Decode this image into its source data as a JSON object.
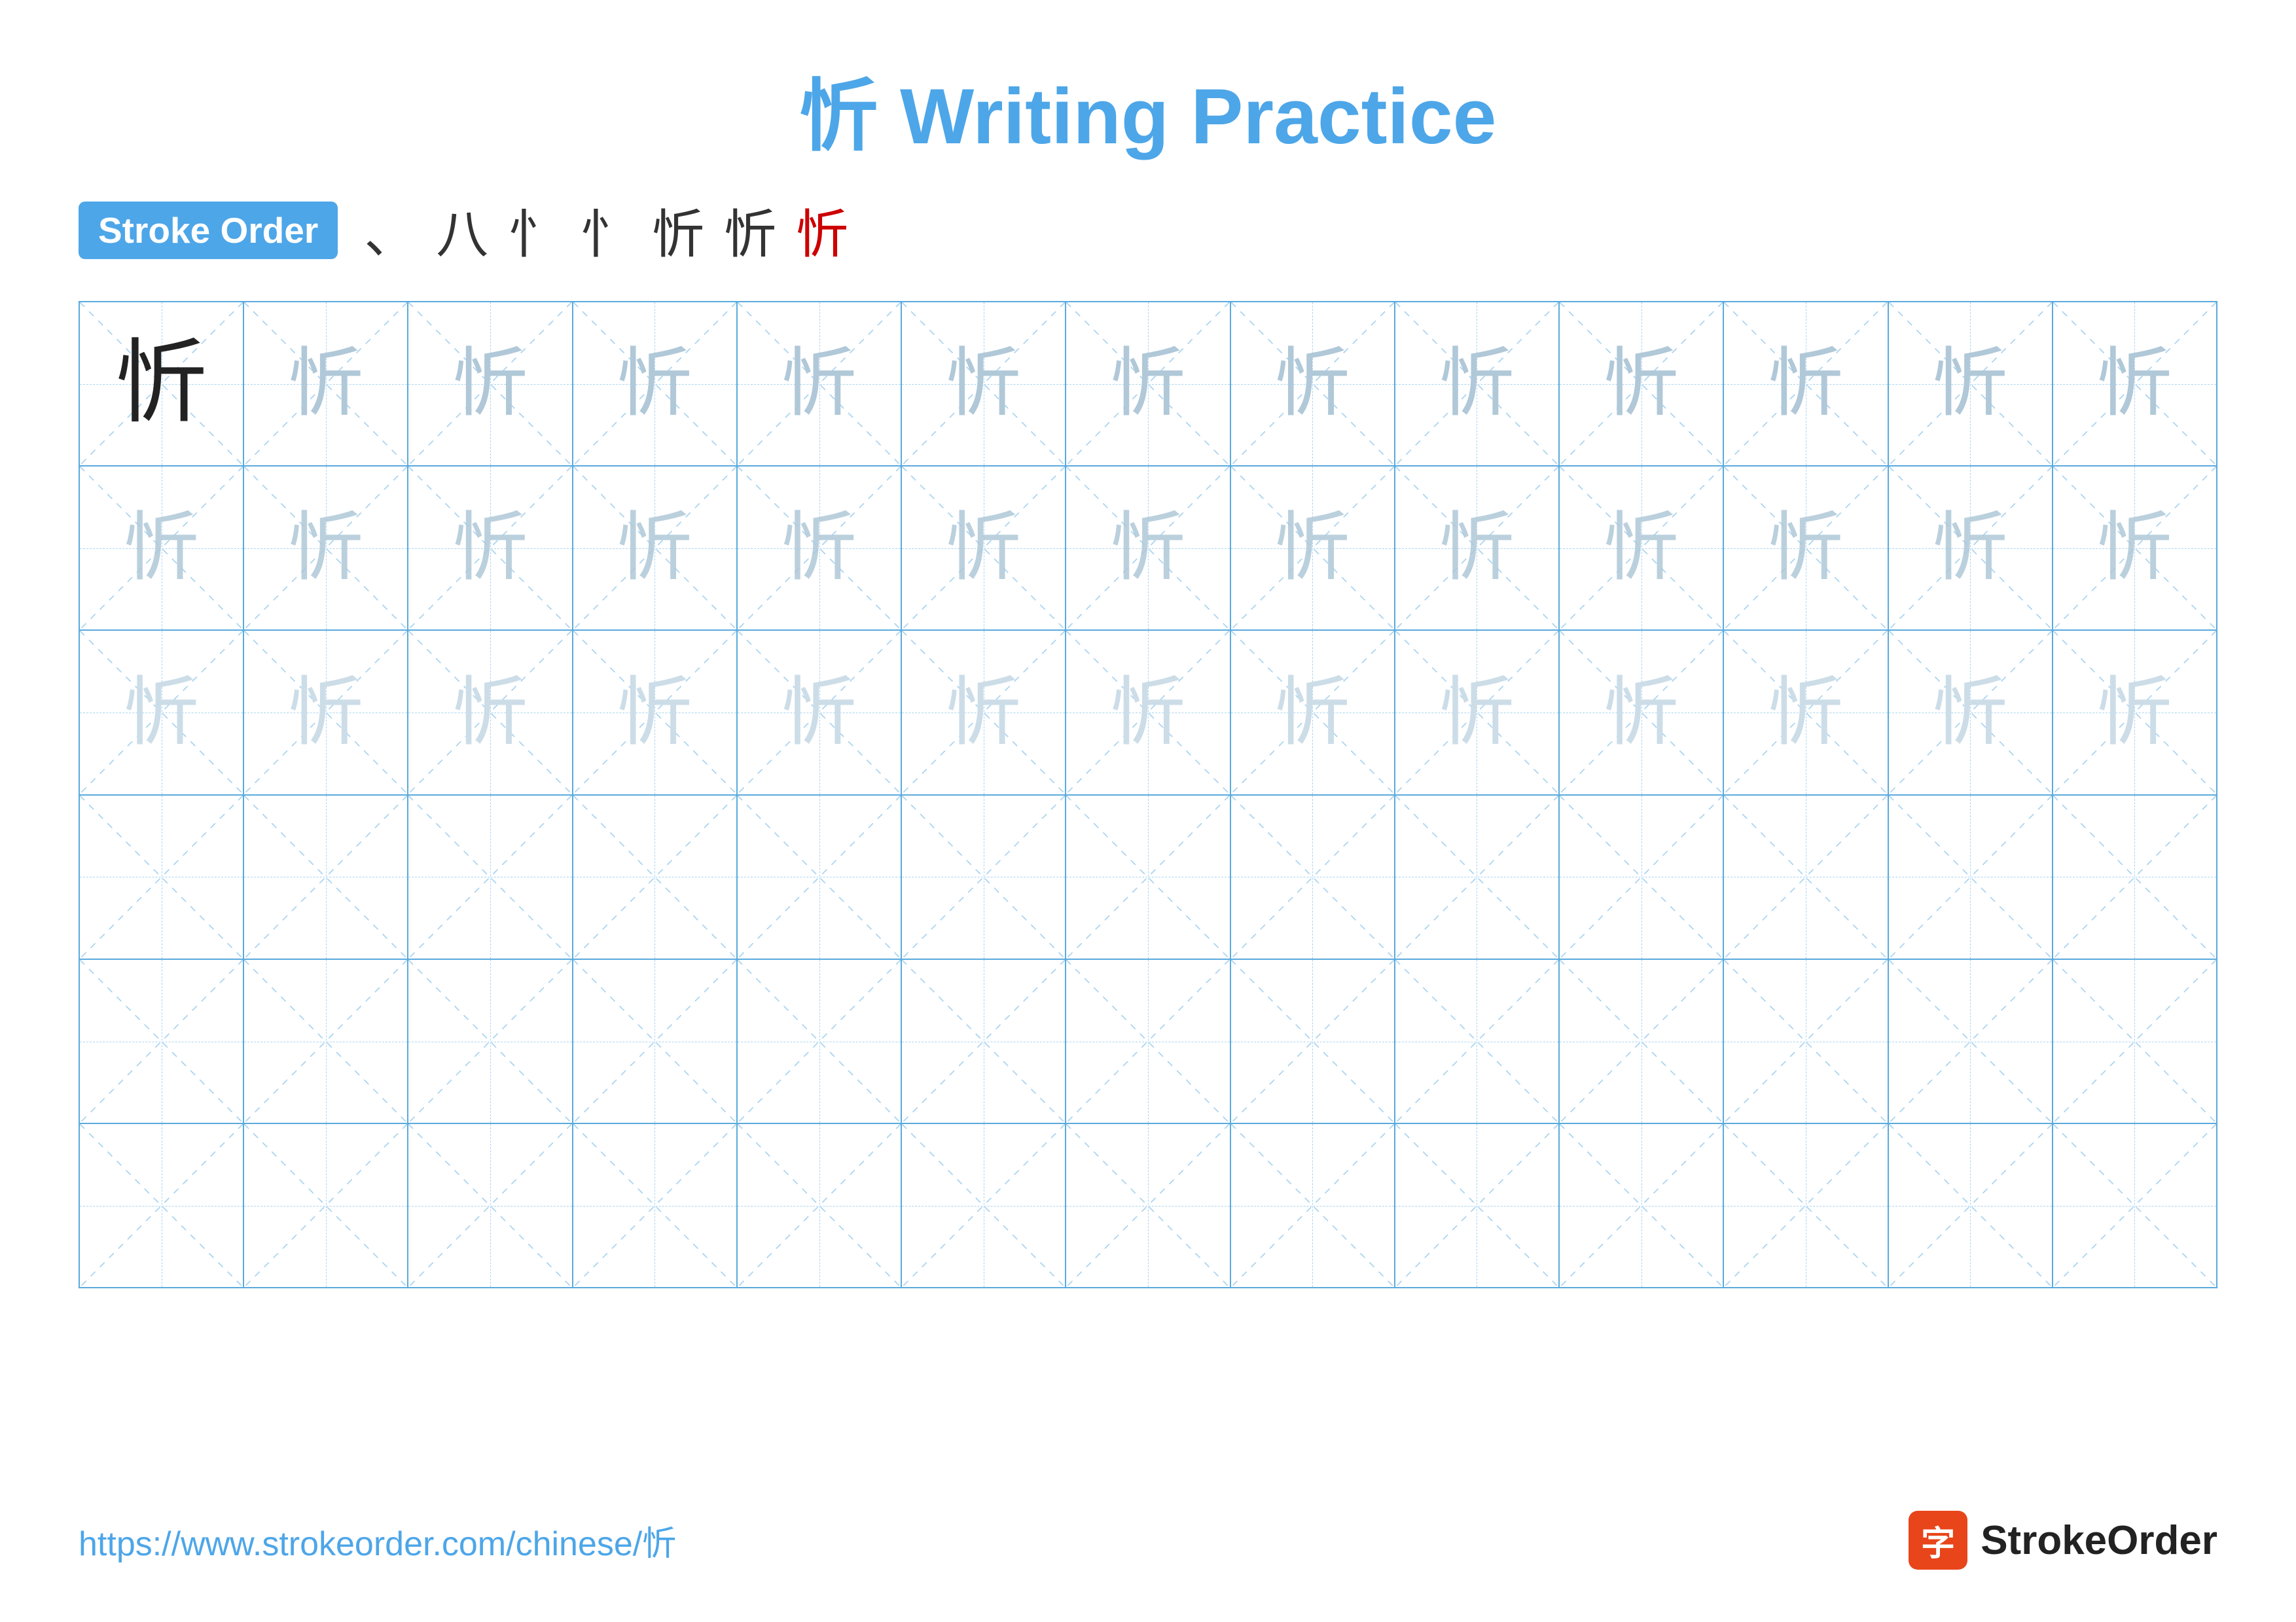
{
  "title": "忻 Writing Practice",
  "stroke_order_badge": "Stroke Order",
  "stroke_sequence": [
    "、",
    "八",
    "忄",
    "忄",
    "忻",
    "忻",
    "忻"
  ],
  "stroke_sequence_last_red_index": 6,
  "character": "忻",
  "rows": [
    {
      "type": "dark",
      "count": 13
    },
    {
      "type": "medium",
      "count": 13
    },
    {
      "type": "light",
      "count": 13
    },
    {
      "type": "empty",
      "count": 13
    },
    {
      "type": "empty",
      "count": 13
    },
    {
      "type": "empty",
      "count": 13
    }
  ],
  "footer_url": "https://www.strokeorder.com/chinese/忻",
  "logo_char": "字",
  "logo_name": "StrokeOrder",
  "colors": {
    "title": "#4da6e8",
    "badge_bg": "#4da6e8",
    "grid_border": "#5aaadd",
    "grid_dashed": "#aad4f0",
    "char_dark": "#222222",
    "char_medium": "#b0c8d8",
    "char_light": "#ccdde8",
    "red": "#cc0000",
    "footer_url": "#4da6e8",
    "logo_bg": "#e8451a"
  }
}
